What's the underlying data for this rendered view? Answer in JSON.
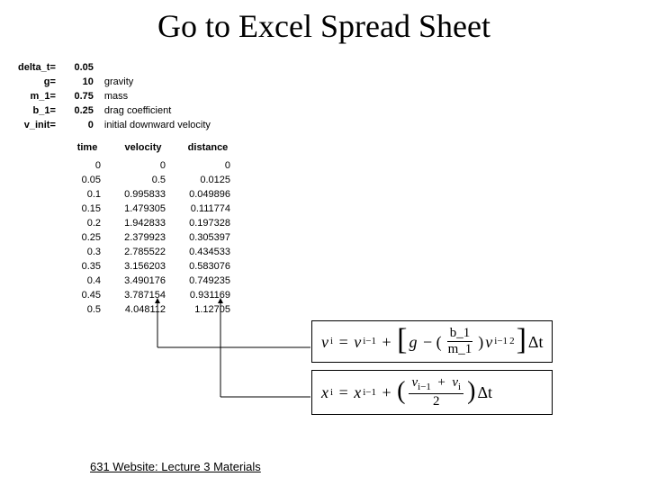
{
  "title": "Go to Excel Spread Sheet",
  "params": [
    {
      "label": "delta_t=",
      "value": "0.05",
      "desc": ""
    },
    {
      "label": "g=",
      "value": "10",
      "desc": "gravity"
    },
    {
      "label": "m_1=",
      "value": "0.75",
      "desc": "mass"
    },
    {
      "label": "b_1=",
      "value": "0.25",
      "desc": "drag coefficient"
    },
    {
      "label": "v_init=",
      "value": "0",
      "desc": "initial downward velocity"
    }
  ],
  "columns": {
    "time": "time",
    "velocity": "velocity",
    "distance": "distance"
  },
  "rows": [
    {
      "t": "0",
      "v": "0",
      "d": "0"
    },
    {
      "t": "0.05",
      "v": "0.5",
      "d": "0.0125"
    },
    {
      "t": "0.1",
      "v": "0.995833",
      "d": "0.049896"
    },
    {
      "t": "0.15",
      "v": "1.479305",
      "d": "0.111774"
    },
    {
      "t": "0.2",
      "v": "1.942833",
      "d": "0.197328"
    },
    {
      "t": "0.25",
      "v": "2.379923",
      "d": "0.305397"
    },
    {
      "t": "0.3",
      "v": "2.785522",
      "d": "0.434533"
    },
    {
      "t": "0.35",
      "v": "3.156203",
      "d": "0.583076"
    },
    {
      "t": "0.4",
      "v": "3.490176",
      "d": "0.749235"
    },
    {
      "t": "0.45",
      "v": "3.787154",
      "d": "0.931169"
    },
    {
      "t": "0.5",
      "v": "4.048112",
      "d": "1.12705"
    }
  ],
  "formula1": {
    "lhs_var": "v",
    "lhs_sub": "i",
    "rhs_var": "v",
    "rhs_sub": "i−1",
    "g": "g",
    "frac_num": "b_1",
    "frac_den": "m_1",
    "inner_var": "v",
    "inner_sub": "i−1",
    "inner_sup": "2",
    "dt": "Δt"
  },
  "formula2": {
    "lhs_var": "x",
    "lhs_sub": "i",
    "rhs_var": "x",
    "rhs_sub": "i−1",
    "num_a_var": "v",
    "num_a_sub": "i−1",
    "num_b_var": "v",
    "num_b_sub": "i",
    "den": "2",
    "dt": "Δt"
  },
  "footer": "631 Website: Lecture 3 Materials",
  "chart_data": {
    "type": "table",
    "title": "Go to Excel Spread Sheet",
    "parameters": {
      "delta_t": 0.05,
      "g": 10,
      "m_1": 0.75,
      "b_1": 0.25,
      "v_init": 0
    },
    "columns": [
      "time",
      "velocity",
      "distance"
    ],
    "data": [
      [
        0,
        0,
        0
      ],
      [
        0.05,
        0.5,
        0.0125
      ],
      [
        0.1,
        0.995833,
        0.049896
      ],
      [
        0.15,
        1.479305,
        0.111774
      ],
      [
        0.2,
        1.942833,
        0.197328
      ],
      [
        0.25,
        2.379923,
        0.305397
      ],
      [
        0.3,
        2.785522,
        0.434533
      ],
      [
        0.35,
        3.156203,
        0.583076
      ],
      [
        0.4,
        3.490176,
        0.749235
      ],
      [
        0.45,
        3.787154,
        0.931169
      ],
      [
        0.5,
        4.048112,
        1.12705
      ]
    ]
  }
}
